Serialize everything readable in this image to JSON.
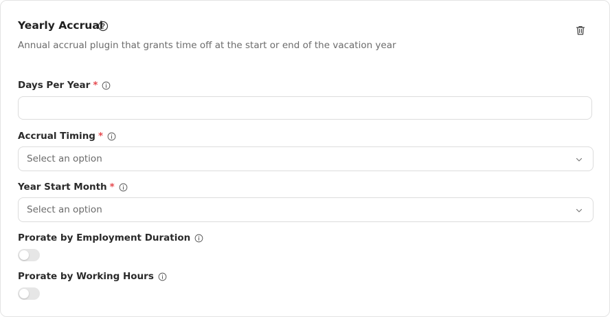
{
  "card": {
    "title": "Yearly Accrual",
    "subtitle": "Annual accrual plugin that grants time off at the start or end of the vacation year"
  },
  "fields": {
    "days_per_year": {
      "label": "Days Per Year",
      "required_mark": "*",
      "value": ""
    },
    "accrual_timing": {
      "label": "Accrual Timing",
      "required_mark": "*",
      "placeholder": "Select an option"
    },
    "year_start_month": {
      "label": "Year Start Month",
      "required_mark": "*",
      "placeholder": "Select an option"
    },
    "prorate_employment": {
      "label": "Prorate by Employment Duration",
      "enabled": false
    },
    "prorate_hours": {
      "label": "Prorate by Working Hours",
      "enabled": false
    }
  },
  "colors": {
    "required": "#e5484d",
    "toggle_off": "#e6e6e6",
    "border": "#dcdcdc"
  },
  "icons": {
    "help": "question-circle-icon",
    "info": "info-circle-icon",
    "delete": "trash-icon",
    "dropdown": "chevron-down-icon"
  }
}
